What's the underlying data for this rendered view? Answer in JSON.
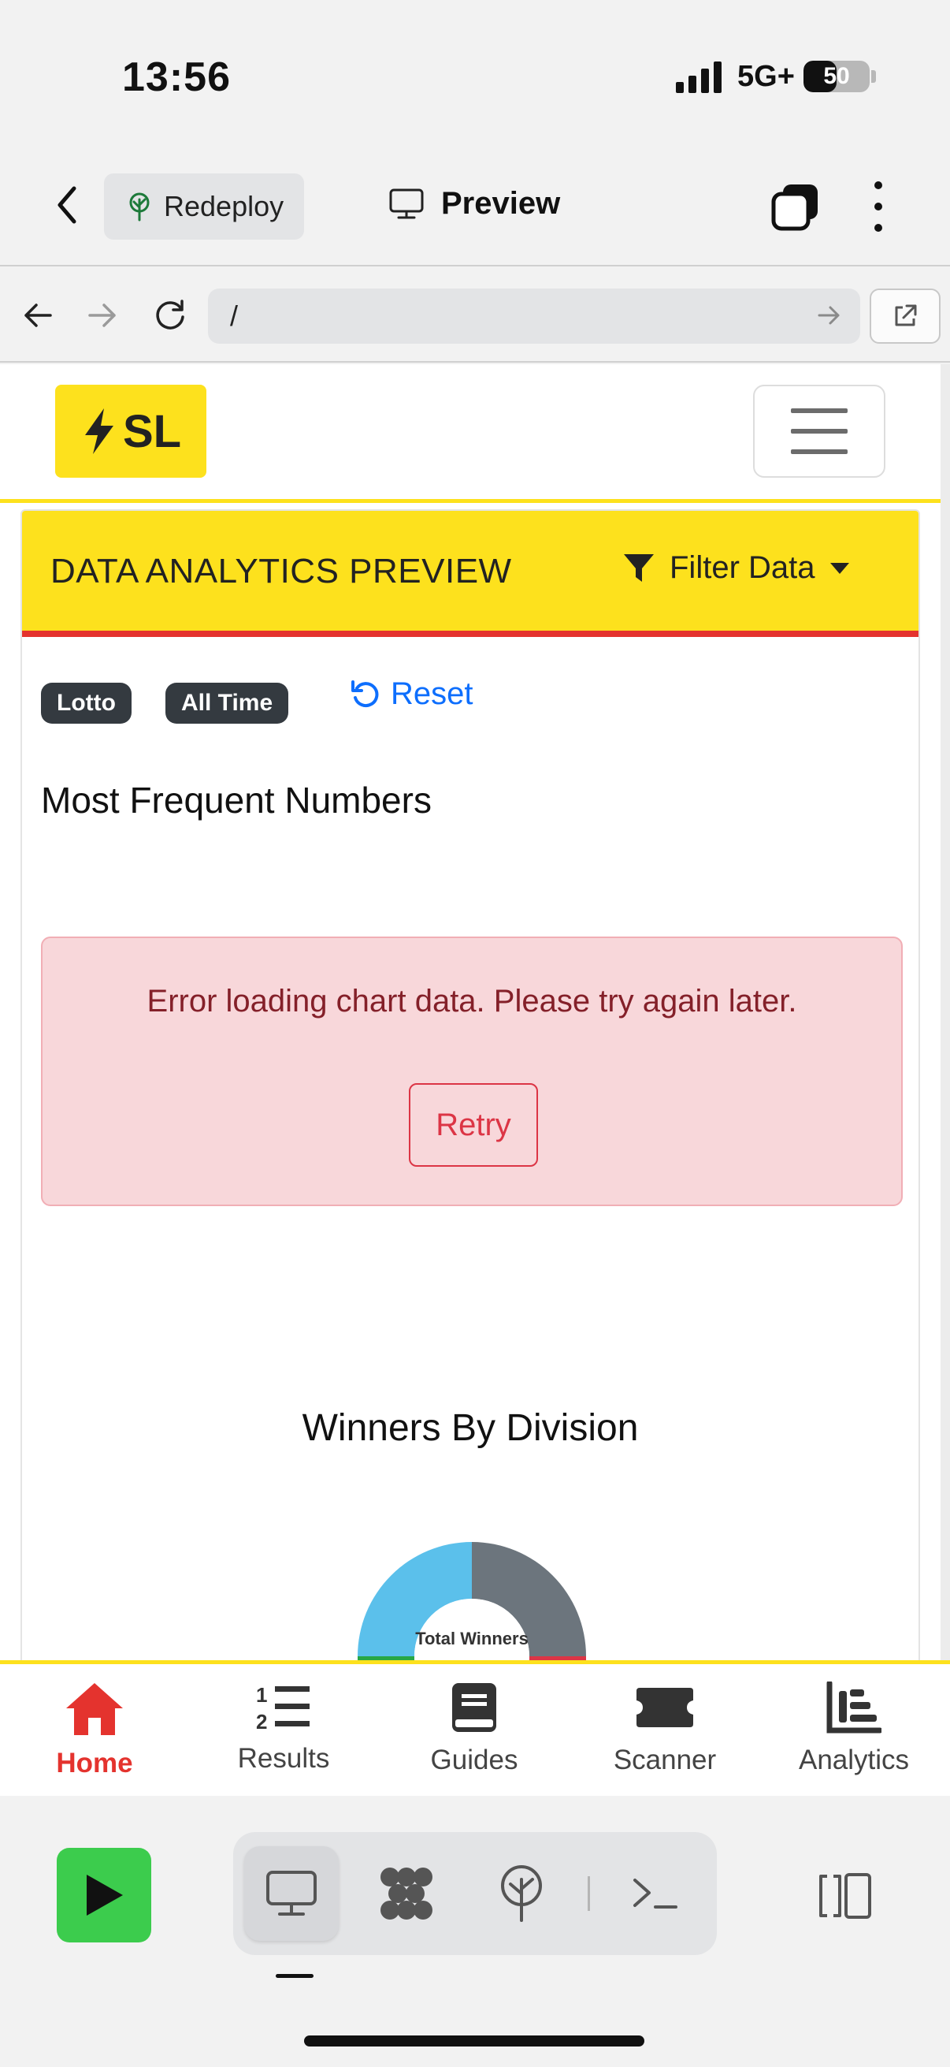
{
  "status_bar": {
    "time": "13:56",
    "network": "5G+",
    "battery": "50",
    "battery_level": 0.5
  },
  "app_header": {
    "redeploy_label": "Redeploy",
    "title": "Preview"
  },
  "browser": {
    "url": "/"
  },
  "site": {
    "logo_text": "SL",
    "card": {
      "title": "DATA ANALYTICS PREVIEW",
      "filter_label": "Filter Data",
      "badges": [
        "Lotto",
        "All Time"
      ],
      "reset_label": "Reset",
      "section_title": "Most Frequent Numbers",
      "error": {
        "message": "Error loading chart data. Please try again later.",
        "retry_label": "Retry"
      },
      "chart_title": "Winners By Division",
      "chart_center_label": "Total Winners"
    },
    "chart_colors": {
      "blue": "#5bc0eb",
      "gray": "#6c757d",
      "green": "#28a745",
      "red": "#dc3545"
    }
  },
  "tabs": [
    {
      "label": "Home",
      "icon": "home-icon",
      "active": true
    },
    {
      "label": "Results",
      "icon": "list-numbered-icon",
      "active": false
    },
    {
      "label": "Guides",
      "icon": "book-icon",
      "active": false
    },
    {
      "label": "Scanner",
      "icon": "ticket-icon",
      "active": false
    },
    {
      "label": "Analytics",
      "icon": "bar-chart-icon",
      "active": false
    }
  ],
  "toolbar": {
    "items": [
      "run-icon",
      "preview-icon",
      "workspace-icon",
      "deploy-icon",
      "shell-icon",
      "panel-icon"
    ]
  },
  "colors": {
    "accent_yellow": "#fde11d",
    "accent_red": "#e4332e",
    "link_blue": "#0d6efd",
    "run_green": "#3ccc4d"
  }
}
